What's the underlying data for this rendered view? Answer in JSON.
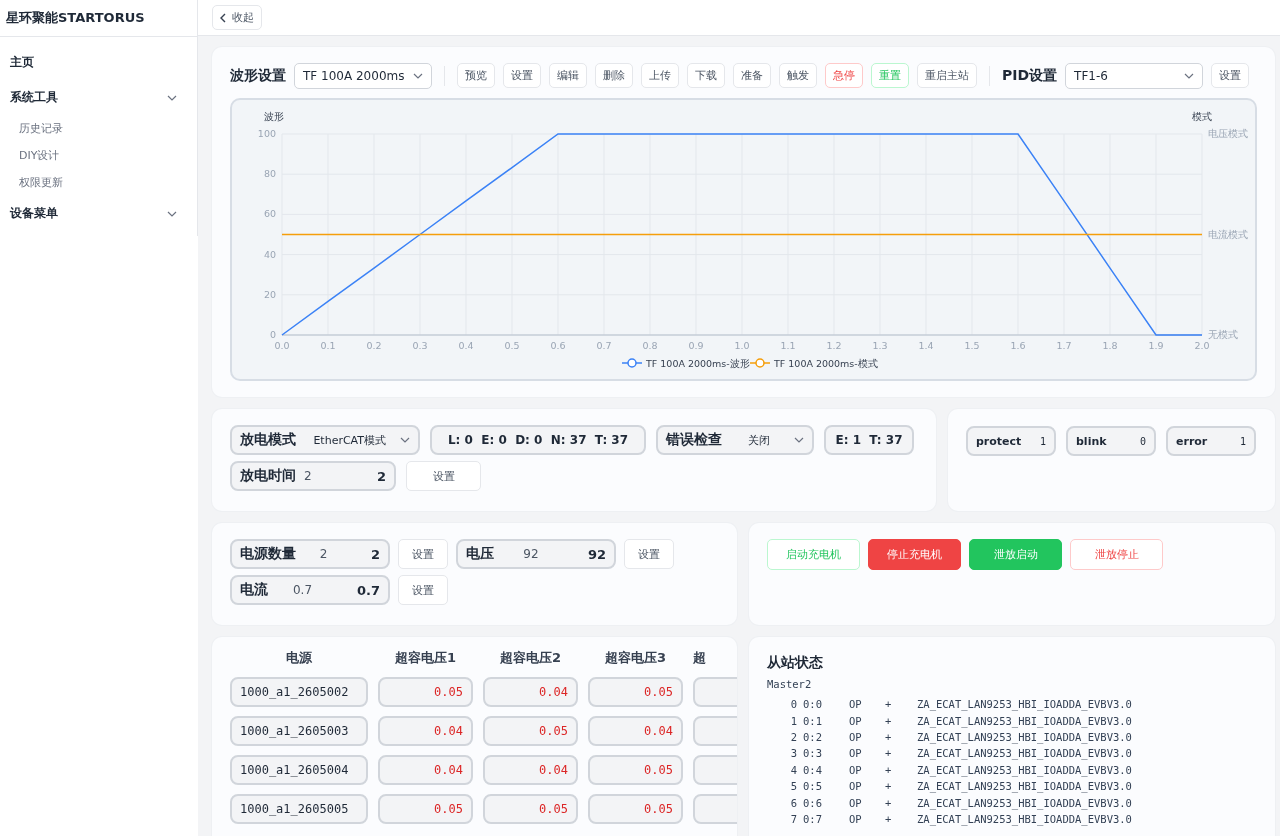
{
  "sidebar": {
    "brand": "星环聚能STARTORUS",
    "items": [
      {
        "label": "主页",
        "kind": "link"
      },
      {
        "label": "系统工具",
        "kind": "submenu",
        "children": [
          {
            "label": "历史记录"
          },
          {
            "label": "DIY设计"
          },
          {
            "label": "权限更新"
          }
        ]
      },
      {
        "label": "设备菜单",
        "kind": "submenu"
      }
    ]
  },
  "topbar": {
    "collapse_button": "收起"
  },
  "waveform_panel": {
    "label": "波形设置",
    "waveform_select": "TF 100A 2000ms",
    "buttons": [
      {
        "label": "预览",
        "kind": "default"
      },
      {
        "label": "设置",
        "kind": "default"
      },
      {
        "label": "编辑",
        "kind": "default"
      },
      {
        "label": "删除",
        "kind": "default"
      },
      {
        "label": "上传",
        "kind": "default"
      },
      {
        "label": "下载",
        "kind": "default"
      },
      {
        "label": "准备",
        "kind": "default"
      },
      {
        "label": "触发",
        "kind": "default"
      },
      {
        "label": "急停",
        "kind": "danger"
      },
      {
        "label": "重置",
        "kind": "success"
      },
      {
        "label": "重启主站",
        "kind": "default"
      }
    ],
    "pid_label": "PID设置",
    "pid_select": "TF1-6",
    "pid_button": "设置",
    "chart": {
      "mode_axis": {
        "label": "模式",
        "ticks": [
          "电压模式",
          "电流模式",
          "无模式"
        ]
      },
      "chart_data": {
        "type": "line",
        "grid": true,
        "legend": true,
        "ylabel": "波形",
        "x": [
          0,
          0.1,
          0.2,
          0.3,
          0.4,
          0.5,
          0.6,
          0.7,
          0.8,
          0.9,
          1,
          1.1,
          1.2,
          1.3,
          1.4,
          1.5,
          1.6,
          1.7,
          1.8,
          1.9,
          2
        ],
        "xlim": [
          0,
          2
        ],
        "ylim": [
          0,
          100
        ],
        "xticks": [
          {
            "value": 0,
            "label": "0.0"
          },
          0.1,
          0.2,
          0.3,
          0.4,
          0.5,
          0.6,
          0.7,
          0.8,
          0.9,
          {
            "value": 1,
            "label": "1.0"
          },
          1.1,
          1.2,
          1.3,
          1.4,
          1.5,
          1.6,
          1.7,
          1.8,
          1.9,
          {
            "value": 2,
            "label": "2.0"
          }
        ],
        "yticks": [
          0,
          20,
          40,
          60,
          80,
          100
        ],
        "series": [
          {
            "name": "TF 100A 2000ms-波形",
            "color": "#3b82f6",
            "values": [
              0,
              16.7,
              33.3,
              50,
              66.7,
              83.3,
              100,
              100,
              100,
              100,
              100,
              100,
              100,
              100,
              100,
              100,
              100,
              66.7,
              33.3,
              0,
              0
            ]
          },
          {
            "name": "TF 100A 2000ms-模式",
            "color": "#f59e0b",
            "values": [
              50,
              50,
              50,
              50,
              50,
              50,
              50,
              50,
              50,
              50,
              50,
              50,
              50,
              50,
              50,
              50,
              50,
              50,
              50,
              50,
              50
            ]
          }
        ]
      }
    }
  },
  "discharge_panel": {
    "mode": {
      "label": "放电模式",
      "value": "EtherCAT模式"
    },
    "counters": "L: 0  E: 0  D: 0  N: 37  T: 37",
    "error_check": {
      "label": "错误检查",
      "value": "关闭"
    },
    "error_counters": "E: 1  T: 37",
    "time": {
      "label": "放电时间",
      "input": "2",
      "value": "2",
      "button": "设置"
    }
  },
  "flags": [
    {
      "label": "protect",
      "value": "1"
    },
    {
      "label": "blink",
      "value": "0"
    },
    {
      "label": "error",
      "value": "1"
    }
  ],
  "power_panel": [
    {
      "label": "电源数量",
      "input": "2",
      "value": "2",
      "button": "设置"
    },
    {
      "label": "电压",
      "input": "92",
      "value": "92",
      "button": "设置"
    },
    {
      "label": "电流",
      "input": "0.7",
      "value": "0.7",
      "button": "设置"
    }
  ],
  "charger_buttons": [
    {
      "label": "启动充电机",
      "kind": "success-outline"
    },
    {
      "label": "停止充电机",
      "kind": "danger-solid"
    },
    {
      "label": "泄放启动",
      "kind": "success-solid"
    },
    {
      "label": "泄放停止",
      "kind": "danger-outline"
    }
  ],
  "supply_table": {
    "columns": [
      "电源",
      "超容电压1",
      "超容电压2",
      "超容电压3",
      "超"
    ],
    "rows": [
      [
        "1000_a1_2605002",
        "0.05",
        "0.04",
        "0.05",
        ""
      ],
      [
        "1000_a1_2605003",
        "0.04",
        "0.05",
        "0.04",
        ""
      ],
      [
        "1000_a1_2605004",
        "0.04",
        "0.04",
        "0.05",
        ""
      ],
      [
        "1000_a1_2605005",
        "0.05",
        "0.05",
        "0.05",
        ""
      ]
    ]
  },
  "slave_status": {
    "title": "从站状态",
    "master": "Master2",
    "slaves": [
      {
        "index": "0",
        "position": "0:0",
        "state": "OP",
        "flag": "+",
        "name": "ZA_ECAT_LAN9253_HBI_IOADDA_EVBV3.0"
      },
      {
        "index": "1",
        "position": "0:1",
        "state": "OP",
        "flag": "+",
        "name": "ZA_ECAT_LAN9253_HBI_IOADDA_EVBV3.0"
      },
      {
        "index": "2",
        "position": "0:2",
        "state": "OP",
        "flag": "+",
        "name": "ZA_ECAT_LAN9253_HBI_IOADDA_EVBV3.0"
      },
      {
        "index": "3",
        "position": "0:3",
        "state": "OP",
        "flag": "+",
        "name": "ZA_ECAT_LAN9253_HBI_IOADDA_EVBV3.0"
      },
      {
        "index": "4",
        "position": "0:4",
        "state": "OP",
        "flag": "+",
        "name": "ZA_ECAT_LAN9253_HBI_IOADDA_EVBV3.0"
      },
      {
        "index": "5",
        "position": "0:5",
        "state": "OP",
        "flag": "+",
        "name": "ZA_ECAT_LAN9253_HBI_IOADDA_EVBV3.0"
      },
      {
        "index": "6",
        "position": "0:6",
        "state": "OP",
        "flag": "+",
        "name": "ZA_ECAT_LAN9253_HBI_IOADDA_EVBV3.0"
      },
      {
        "index": "7",
        "position": "0:7",
        "state": "OP",
        "flag": "+",
        "name": "ZA_ECAT_LAN9253_HBI_IOADDA_EVBV3.0"
      }
    ]
  }
}
